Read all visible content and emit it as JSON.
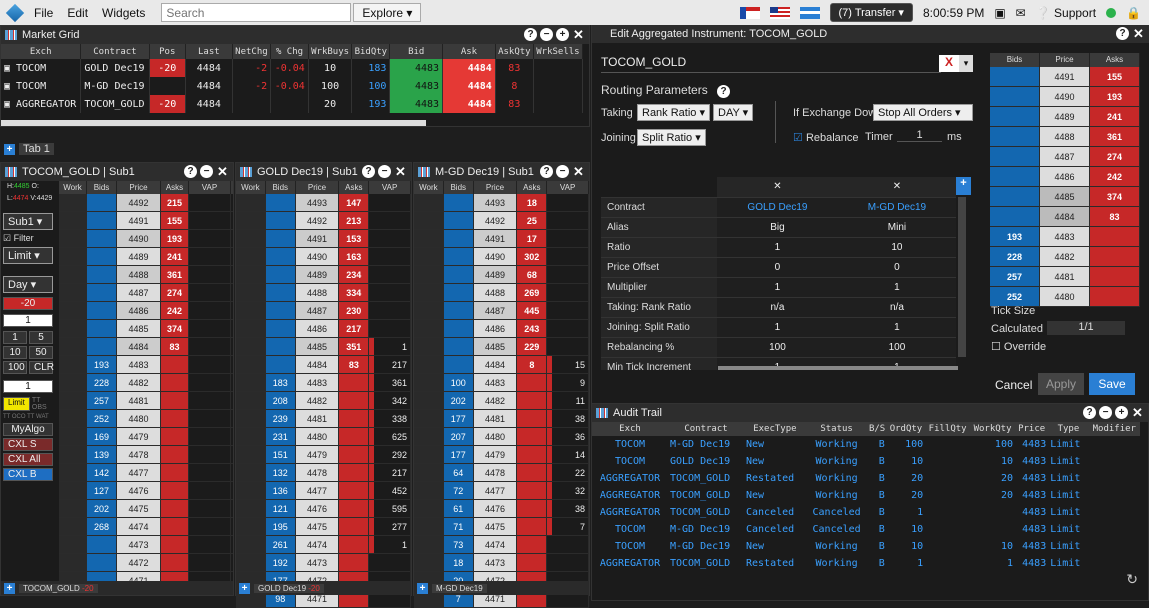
{
  "menu": {
    "items": [
      "File",
      "Edit",
      "Widgets"
    ],
    "search_placeholder": "Search",
    "explore": "Explore ▾",
    "transfer": "(7) Transfer ▾",
    "time": "8:00:59 PM",
    "support": "Support"
  },
  "market_grid": {
    "title": "Market Grid",
    "columns": [
      "Exch",
      "Contract",
      "Pos",
      "Last",
      "NetChg",
      "% Chg",
      "WrkBuys",
      "BidQty",
      "Bid",
      "Ask",
      "AskQty",
      "WrkSells"
    ],
    "rows": [
      [
        "TOCOM",
        "GOLD Dec19",
        "-20",
        "4484",
        "-2",
        "-0.04",
        "10",
        "183",
        "4483",
        "4484",
        "83",
        ""
      ],
      [
        "TOCOM",
        "M-GD Dec19",
        "",
        "4484",
        "-2",
        "-0.04",
        "100",
        "100",
        "4483",
        "4484",
        "8",
        ""
      ],
      [
        "AGGREGATOR",
        "TOCOM_GOLD",
        "-20",
        "4484",
        "",
        "",
        "20",
        "193",
        "4483",
        "4484",
        "83",
        ""
      ]
    ],
    "tab": "Tab 1"
  },
  "ladder1": {
    "title": "TOCOM_GOLD | Sub1",
    "h": "4485",
    "l": "4474",
    "o": "",
    "v": "4429",
    "side": {
      "sub": "Sub1 ▾",
      "filter": "Filter",
      "limit": "Limit ▾",
      "day": "Day ▾",
      "pos": "-20",
      "qty": "1",
      "q1": "1",
      "q5": "5",
      "q10": "10",
      "q50": "50",
      "q100": "100",
      "clr": "CLR",
      "one": "1",
      "limitbtn": "Limit",
      "tt": "TT OBS",
      "ttoco": "TT OCO TT WAT",
      "myalgo": "MyAlgo",
      "cxls": "CXL S",
      "cxlall": "CXL All",
      "cxlb": "CXL B",
      "tab": "TOCOM_GOLD",
      "tabpos": "-20"
    },
    "cols": [
      "Work",
      "Bids",
      "Price",
      "Asks",
      "VAP"
    ],
    "rows": [
      [
        "",
        "",
        "4492",
        "215",
        ""
      ],
      [
        "",
        "",
        "4491",
        "155",
        ""
      ],
      [
        "",
        "",
        "4490",
        "193",
        ""
      ],
      [
        "",
        "",
        "4489",
        "241",
        ""
      ],
      [
        "",
        "",
        "4488",
        "361",
        ""
      ],
      [
        "",
        "",
        "4487",
        "274",
        ""
      ],
      [
        "",
        "",
        "4486",
        "242",
        ""
      ],
      [
        "",
        "",
        "4485",
        "374",
        ""
      ],
      [
        "",
        "",
        "4484",
        "83",
        ""
      ],
      [
        "",
        "193",
        "4483",
        "",
        ""
      ],
      [
        "",
        "228",
        "4482",
        "",
        ""
      ],
      [
        "",
        "257",
        "4481",
        "",
        ""
      ],
      [
        "",
        "252",
        "4480",
        "",
        ""
      ],
      [
        "",
        "169",
        "4479",
        "",
        ""
      ],
      [
        "",
        "139",
        "4478",
        "",
        ""
      ],
      [
        "",
        "142",
        "4477",
        "",
        ""
      ],
      [
        "",
        "127",
        "4476",
        "",
        ""
      ],
      [
        "",
        "202",
        "4475",
        "",
        ""
      ],
      [
        "",
        "268",
        "4474",
        "",
        ""
      ],
      [
        "",
        "",
        "4473",
        "",
        ""
      ],
      [
        "",
        "",
        "4472",
        "",
        ""
      ],
      [
        "",
        "",
        "4471",
        "",
        ""
      ]
    ]
  },
  "ladder2": {
    "title": "GOLD Dec19 | Sub1",
    "cols": [
      "Work",
      "Bids",
      "Price",
      "Asks",
      "VAP"
    ],
    "tab": "GOLD Dec19",
    "tabpos": "-20",
    "rows": [
      [
        "",
        "",
        "4493",
        "147",
        ""
      ],
      [
        "",
        "",
        "4492",
        "213",
        ""
      ],
      [
        "",
        "",
        "4491",
        "153",
        ""
      ],
      [
        "",
        "",
        "4490",
        "163",
        ""
      ],
      [
        "",
        "",
        "4489",
        "234",
        ""
      ],
      [
        "",
        "",
        "4488",
        "334",
        ""
      ],
      [
        "",
        "",
        "4487",
        "230",
        ""
      ],
      [
        "",
        "",
        "4486",
        "217",
        ""
      ],
      [
        "",
        "",
        "4485",
        "351",
        "1"
      ],
      [
        "",
        "",
        "4484",
        "83",
        "217"
      ],
      [
        "",
        "183",
        "4483",
        "",
        "361"
      ],
      [
        "",
        "208",
        "4482",
        "",
        "342"
      ],
      [
        "",
        "239",
        "4481",
        "",
        "338"
      ],
      [
        "",
        "231",
        "4480",
        "",
        "625"
      ],
      [
        "",
        "151",
        "4479",
        "",
        "292"
      ],
      [
        "",
        "132",
        "4478",
        "",
        "217"
      ],
      [
        "",
        "136",
        "4477",
        "",
        "452"
      ],
      [
        "",
        "121",
        "4476",
        "",
        "595"
      ],
      [
        "",
        "195",
        "4475",
        "",
        "277"
      ],
      [
        "",
        "261",
        "4474",
        "",
        "1"
      ],
      [
        "",
        "192",
        "4473",
        "",
        ""
      ],
      [
        "",
        "177",
        "4472",
        "",
        ""
      ],
      [
        "",
        "98",
        "4471",
        "",
        ""
      ]
    ]
  },
  "ladder3": {
    "title": "M-GD Dec19 | Sub1",
    "cols": [
      "Work",
      "Bids",
      "Price",
      "Asks",
      "VAP"
    ],
    "tab": "M-GD Dec19",
    "rows": [
      [
        "",
        "",
        "4493",
        "18",
        ""
      ],
      [
        "",
        "",
        "4492",
        "25",
        ""
      ],
      [
        "",
        "",
        "4491",
        "17",
        ""
      ],
      [
        "",
        "",
        "4490",
        "302",
        ""
      ],
      [
        "",
        "",
        "4489",
        "68",
        ""
      ],
      [
        "",
        "",
        "4488",
        "269",
        ""
      ],
      [
        "",
        "",
        "4487",
        "445",
        ""
      ],
      [
        "",
        "",
        "4486",
        "243",
        ""
      ],
      [
        "",
        "",
        "4485",
        "229",
        ""
      ],
      [
        "",
        "",
        "4484",
        "8",
        "15"
      ],
      [
        "",
        "100",
        "4483",
        "",
        "9"
      ],
      [
        "",
        "202",
        "4482",
        "",
        "11"
      ],
      [
        "",
        "177",
        "4481",
        "",
        "38"
      ],
      [
        "",
        "207",
        "4480",
        "",
        "36"
      ],
      [
        "",
        "177",
        "4479",
        "",
        "14"
      ],
      [
        "",
        "64",
        "4478",
        "",
        "22"
      ],
      [
        "",
        "72",
        "4477",
        "",
        "32"
      ],
      [
        "",
        "61",
        "4476",
        "",
        "38"
      ],
      [
        "",
        "71",
        "4475",
        "",
        "7"
      ],
      [
        "",
        "73",
        "4474",
        "",
        ""
      ],
      [
        "",
        "18",
        "4473",
        "",
        ""
      ],
      [
        "",
        "20",
        "4472",
        "",
        ""
      ],
      [
        "",
        "7",
        "4471",
        "",
        ""
      ]
    ]
  },
  "edit": {
    "title": "Edit Aggregated Instrument: TOCOM_GOLD",
    "name": "TOCOM_GOLD",
    "routing": "Routing Parameters",
    "taking": "Taking",
    "taking_val": "Rank Ratio ▾",
    "day": "DAY ▾",
    "joining": "Joining",
    "joining_val": "Split Ratio ▾",
    "exch_down": "If Exchange Down",
    "exch_down_val": "Stop All Orders ▾",
    "rebalance": "Rebalance",
    "timer": "Timer",
    "timer_val": "1",
    "ms": "ms",
    "grid_rows": [
      [
        "Contract",
        "GOLD Dec19",
        "M-GD Dec19"
      ],
      [
        "Alias",
        "Big",
        "Mini"
      ],
      [
        "Ratio",
        "1",
        "10"
      ],
      [
        "Price Offset",
        "0",
        "0"
      ],
      [
        "Multiplier",
        "1",
        "1"
      ],
      [
        "Taking: Rank Ratio",
        "n/a",
        "n/a"
      ],
      [
        "Joining: Split Ratio",
        "1",
        "1"
      ],
      [
        "Rebalancing %",
        "100",
        "100"
      ],
      [
        "Min Tick Increment",
        "1",
        "1"
      ]
    ],
    "mini_cols": [
      "Bids",
      "Price",
      "Asks"
    ],
    "mini_rows": [
      [
        "",
        "4491",
        "155"
      ],
      [
        "",
        "4490",
        "193"
      ],
      [
        "",
        "4489",
        "241"
      ],
      [
        "",
        "4488",
        "361"
      ],
      [
        "",
        "4487",
        "274"
      ],
      [
        "",
        "4486",
        "242"
      ],
      [
        "",
        "4485",
        "374"
      ],
      [
        "",
        "4484",
        "83"
      ],
      [
        "193",
        "4483",
        ""
      ],
      [
        "228",
        "4482",
        ""
      ],
      [
        "257",
        "4481",
        ""
      ],
      [
        "252",
        "4480",
        ""
      ]
    ],
    "tick_size": "Tick Size",
    "calculated": "Calculated",
    "calc_val": "1/1",
    "override": "Override",
    "cancel": "Cancel",
    "apply": "Apply",
    "save": "Save"
  },
  "audit": {
    "title": "Audit Trail",
    "cols": [
      "Exch",
      "Contract",
      "ExecType",
      "Status",
      "B/S",
      "OrdQty",
      "FillQty",
      "WorkQty",
      "Price",
      "Type",
      "Modifier"
    ],
    "rows": [
      [
        "TOCOM",
        "M-GD Dec19",
        "New",
        "Working",
        "B",
        "100",
        "",
        "100",
        "4483",
        "Limit",
        ""
      ],
      [
        "TOCOM",
        "GOLD Dec19",
        "New",
        "Working",
        "B",
        "10",
        "",
        "10",
        "4483",
        "Limit",
        ""
      ],
      [
        "AGGREGATOR",
        "TOCOM_GOLD",
        "Restated",
        "Working",
        "B",
        "20",
        "",
        "20",
        "4483",
        "Limit",
        ""
      ],
      [
        "AGGREGATOR",
        "TOCOM_GOLD",
        "New",
        "Working",
        "B",
        "20",
        "",
        "20",
        "4483",
        "Limit",
        ""
      ],
      [
        "AGGREGATOR",
        "TOCOM_GOLD",
        "Canceled",
        "Canceled",
        "B",
        "1",
        "",
        "",
        "4483",
        "Limit",
        ""
      ],
      [
        "TOCOM",
        "M-GD Dec19",
        "Canceled",
        "Canceled",
        "B",
        "10",
        "",
        "",
        "4483",
        "Limit",
        ""
      ],
      [
        "TOCOM",
        "M-GD Dec19",
        "New",
        "Working",
        "B",
        "10",
        "",
        "10",
        "4483",
        "Limit",
        ""
      ],
      [
        "AGGREGATOR",
        "TOCOM_GOLD",
        "Restated",
        "Working",
        "B",
        "1",
        "",
        "1",
        "4483",
        "Limit",
        ""
      ]
    ]
  }
}
